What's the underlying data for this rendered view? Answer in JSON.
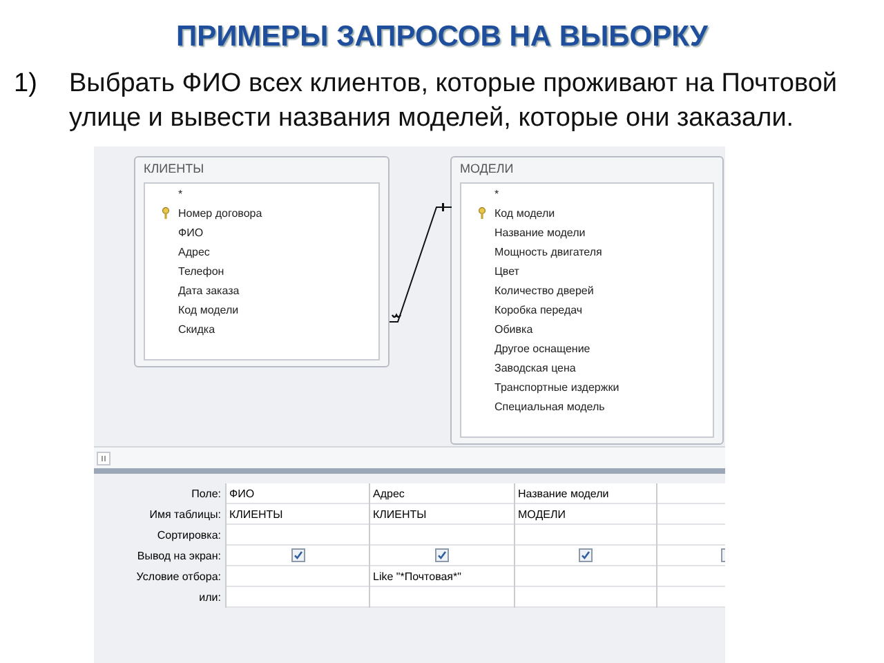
{
  "title": "ПРИМЕРЫ ЗАПРОСОВ НА ВЫБОРКУ",
  "items": [
    {
      "number": "1)",
      "text": "Выбрать ФИО всех клиентов, которые проживают на Почтовой улице и вывести названия моделей, которые они заказали."
    }
  ],
  "query_designer": {
    "tables": [
      {
        "name": "КЛИЕНТЫ",
        "fields": [
          {
            "name": "*",
            "key": false
          },
          {
            "name": "Номер договора",
            "key": true
          },
          {
            "name": "ФИО",
            "key": false
          },
          {
            "name": "Адрес",
            "key": false
          },
          {
            "name": "Телефон",
            "key": false
          },
          {
            "name": "Дата заказа",
            "key": false
          },
          {
            "name": "Код модели",
            "key": false
          },
          {
            "name": "Скидка",
            "key": false
          }
        ]
      },
      {
        "name": "МОДЕЛИ",
        "fields": [
          {
            "name": "*",
            "key": false
          },
          {
            "name": "Код модели",
            "key": true
          },
          {
            "name": "Название модели",
            "key": false
          },
          {
            "name": "Мощность двигателя",
            "key": false
          },
          {
            "name": "Цвет",
            "key": false
          },
          {
            "name": "Количество дверей",
            "key": false
          },
          {
            "name": "Коробка передач",
            "key": false
          },
          {
            "name": "Обивка",
            "key": false
          },
          {
            "name": "Другое оснащение",
            "key": false
          },
          {
            "name": "Заводская цена",
            "key": false
          },
          {
            "name": "Транспортные издержки",
            "key": false
          },
          {
            "name": "Специальная модель",
            "key": false
          }
        ]
      }
    ],
    "grid": {
      "row_labels": [
        "Поле:",
        "Имя таблицы:",
        "Сортировка:",
        "Вывод на экран:",
        "Условие отбора:",
        "или:"
      ],
      "columns": [
        {
          "field": "ФИО",
          "table": "КЛИЕНТЫ",
          "show": true
        },
        {
          "field": "Адрес",
          "table": "КЛИЕНТЫ",
          "criteria": "Like \"*Почтовая*\"",
          "show": true
        },
        {
          "field": "Название модели",
          "table": "МОДЕЛИ",
          "show": true
        },
        {
          "show": false
        }
      ]
    }
  }
}
